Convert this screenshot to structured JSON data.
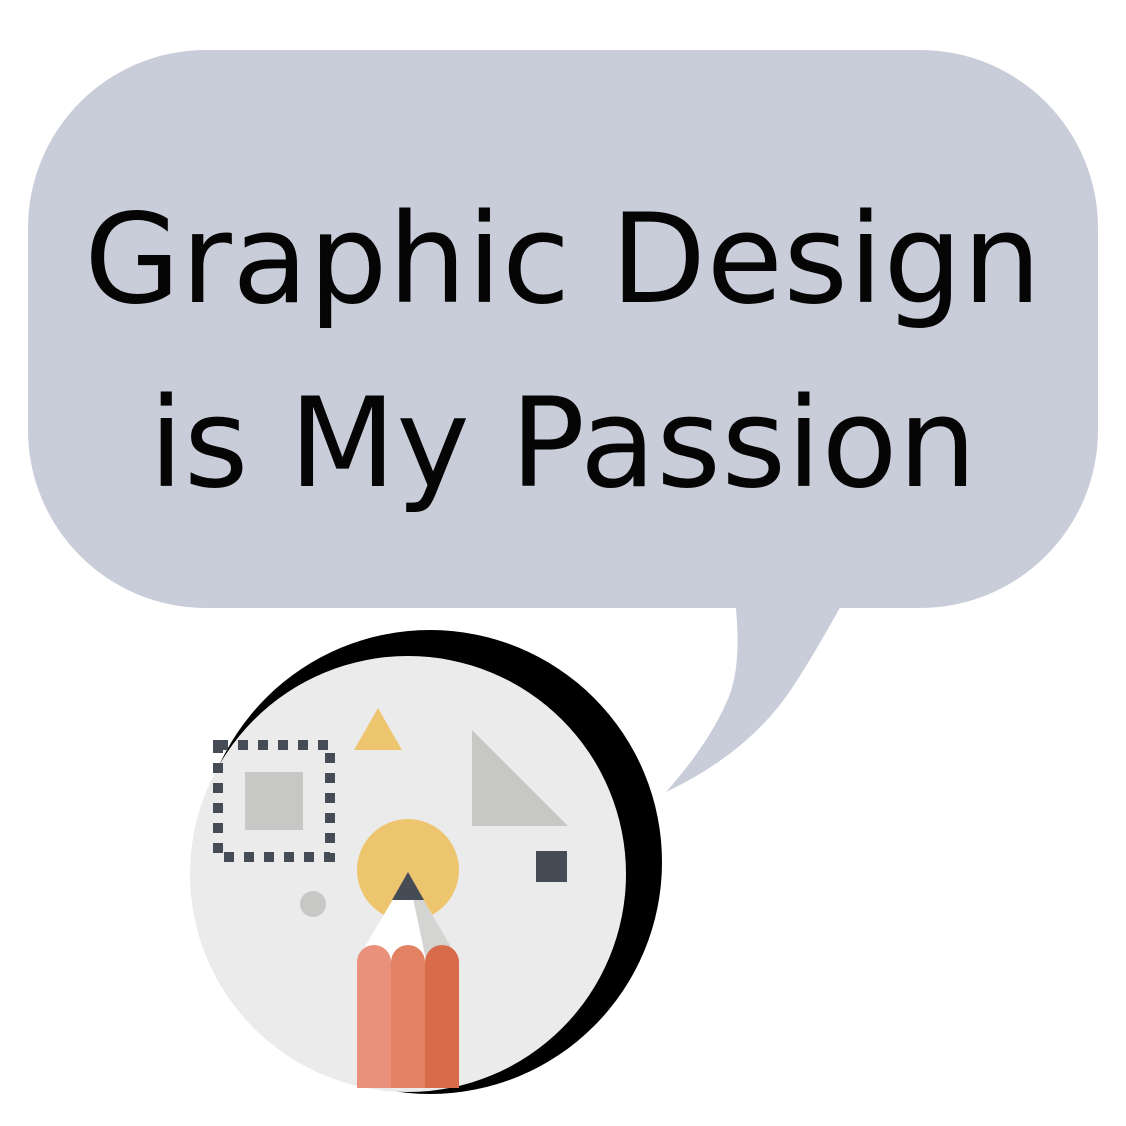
{
  "speech_bubble": {
    "line1": "Graphic Design",
    "line2": "is My Passion",
    "fill_color": "#C9CCD9",
    "text_color": "#050505"
  },
  "illustration": {
    "icon": "design-tools-pencil-icon",
    "circle_fill": "#EBEBEB",
    "shadow_color": "#000000",
    "accent_yellow": "#EEC56F",
    "shape_gray": "#C7C7C5",
    "dark_slate": "#464C55",
    "pencil_colors": [
      "#E9917A",
      "#E38262",
      "#D86C4A"
    ]
  }
}
